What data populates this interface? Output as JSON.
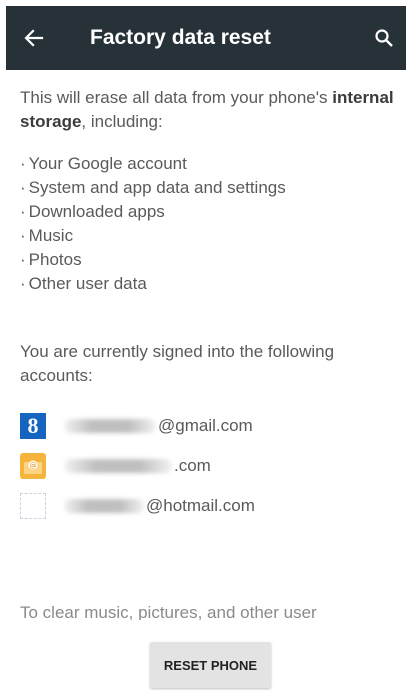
{
  "appbar": {
    "title": "Factory data reset",
    "back_icon": "arrow-back-icon",
    "search_icon": "search-icon",
    "background": "#263238"
  },
  "intro": {
    "text_before": "This will erase all data from your phone's ",
    "bold": "internal storage",
    "text_after": ", including:"
  },
  "erase_items": [
    "Your Google account",
    "System and app data and settings",
    "Downloaded apps",
    "Music",
    "Photos",
    "Other user data"
  ],
  "signed_in_text": "You are currently signed into the following accounts:",
  "accounts": [
    {
      "icon": "google-icon",
      "icon_text": "8",
      "domain": "@gmail.com"
    },
    {
      "icon": "email-icon",
      "domain": ".com"
    },
    {
      "icon": "hotmail-icon",
      "domain": "@hotmail.com"
    }
  ],
  "cutoff_text": "To clear music, pictures, and other user",
  "reset_button": "RESET PHONE"
}
